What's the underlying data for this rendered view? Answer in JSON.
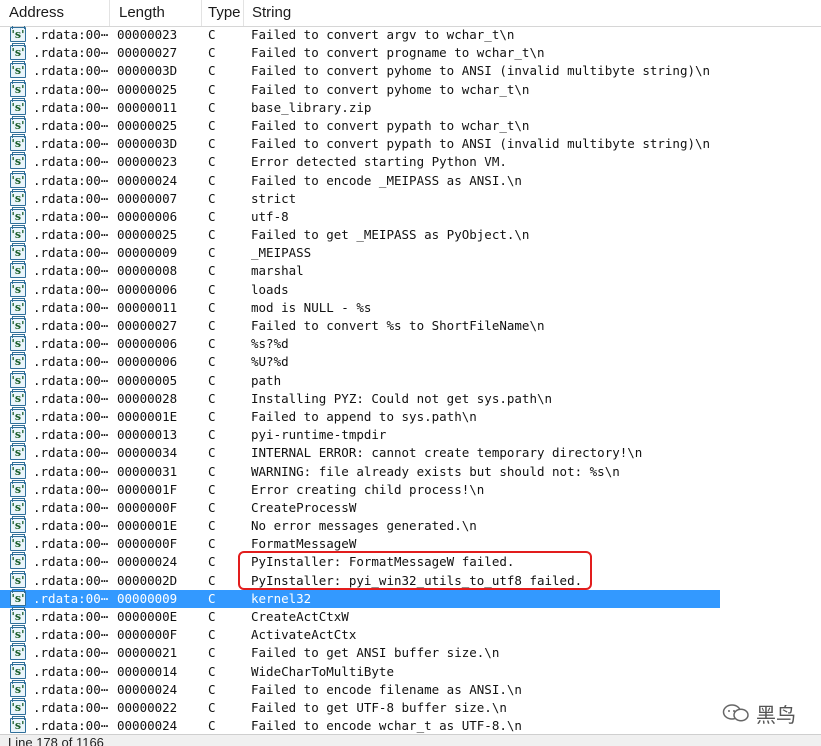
{
  "columns": {
    "address": "Address",
    "length": "Length",
    "type": "Type",
    "string": "String"
  },
  "icon_label": "'s'",
  "rows": [
    {
      "address": ".rdata:00⋯",
      "length": "00000023",
      "type": "C",
      "string": "Failed to convert argv to wchar_t\\n"
    },
    {
      "address": ".rdata:00⋯",
      "length": "00000027",
      "type": "C",
      "string": "Failed to convert progname to wchar_t\\n"
    },
    {
      "address": ".rdata:00⋯",
      "length": "0000003D",
      "type": "C",
      "string": "Failed to convert pyhome to ANSI (invalid multibyte string)\\n"
    },
    {
      "address": ".rdata:00⋯",
      "length": "00000025",
      "type": "C",
      "string": "Failed to convert pyhome to wchar_t\\n"
    },
    {
      "address": ".rdata:00⋯",
      "length": "00000011",
      "type": "C",
      "string": "base_library.zip"
    },
    {
      "address": ".rdata:00⋯",
      "length": "00000025",
      "type": "C",
      "string": "Failed to convert pypath to wchar_t\\n"
    },
    {
      "address": ".rdata:00⋯",
      "length": "0000003D",
      "type": "C",
      "string": "Failed to convert pypath to ANSI (invalid multibyte string)\\n"
    },
    {
      "address": ".rdata:00⋯",
      "length": "00000023",
      "type": "C",
      "string": "Error detected starting Python VM."
    },
    {
      "address": ".rdata:00⋯",
      "length": "00000024",
      "type": "C",
      "string": "Failed to encode _MEIPASS as ANSI.\\n"
    },
    {
      "address": ".rdata:00⋯",
      "length": "00000007",
      "type": "C",
      "string": "strict"
    },
    {
      "address": ".rdata:00⋯",
      "length": "00000006",
      "type": "C",
      "string": "utf-8"
    },
    {
      "address": ".rdata:00⋯",
      "length": "00000025",
      "type": "C",
      "string": "Failed to get _MEIPASS as PyObject.\\n"
    },
    {
      "address": ".rdata:00⋯",
      "length": "00000009",
      "type": "C",
      "string": "_MEIPASS"
    },
    {
      "address": ".rdata:00⋯",
      "length": "00000008",
      "type": "C",
      "string": "marshal"
    },
    {
      "address": ".rdata:00⋯",
      "length": "00000006",
      "type": "C",
      "string": "loads"
    },
    {
      "address": ".rdata:00⋯",
      "length": "00000011",
      "type": "C",
      "string": "mod is NULL - %s"
    },
    {
      "address": ".rdata:00⋯",
      "length": "00000027",
      "type": "C",
      "string": "Failed to convert %s to ShortFileName\\n"
    },
    {
      "address": ".rdata:00⋯",
      "length": "00000006",
      "type": "C",
      "string": "%s?%d"
    },
    {
      "address": ".rdata:00⋯",
      "length": "00000006",
      "type": "C",
      "string": "%U?%d"
    },
    {
      "address": ".rdata:00⋯",
      "length": "00000005",
      "type": "C",
      "string": "path"
    },
    {
      "address": ".rdata:00⋯",
      "length": "00000028",
      "type": "C",
      "string": "Installing PYZ: Could not get sys.path\\n"
    },
    {
      "address": ".rdata:00⋯",
      "length": "0000001E",
      "type": "C",
      "string": "Failed to append to sys.path\\n"
    },
    {
      "address": ".rdata:00⋯",
      "length": "00000013",
      "type": "C",
      "string": "pyi-runtime-tmpdir"
    },
    {
      "address": ".rdata:00⋯",
      "length": "00000034",
      "type": "C",
      "string": "INTERNAL ERROR: cannot create temporary directory!\\n"
    },
    {
      "address": ".rdata:00⋯",
      "length": "00000031",
      "type": "C",
      "string": "WARNING: file already exists but should not: %s\\n"
    },
    {
      "address": ".rdata:00⋯",
      "length": "0000001F",
      "type": "C",
      "string": "Error creating child process!\\n"
    },
    {
      "address": ".rdata:00⋯",
      "length": "0000000F",
      "type": "C",
      "string": "CreateProcessW"
    },
    {
      "address": ".rdata:00⋯",
      "length": "0000001E",
      "type": "C",
      "string": "No error messages generated.\\n"
    },
    {
      "address": ".rdata:00⋯",
      "length": "0000000F",
      "type": "C",
      "string": "FormatMessageW"
    },
    {
      "address": ".rdata:00⋯",
      "length": "00000024",
      "type": "C",
      "string": "PyInstaller: FormatMessageW failed."
    },
    {
      "address": ".rdata:00⋯",
      "length": "0000002D",
      "type": "C",
      "string": "PyInstaller: pyi_win32_utils_to_utf8 failed."
    },
    {
      "address": ".rdata:00⋯",
      "length": "00000009",
      "type": "C",
      "string": "kernel32",
      "selected": true
    },
    {
      "address": ".rdata:00⋯",
      "length": "0000000E",
      "type": "C",
      "string": "CreateActCtxW"
    },
    {
      "address": ".rdata:00⋯",
      "length": "0000000F",
      "type": "C",
      "string": "ActivateActCtx"
    },
    {
      "address": ".rdata:00⋯",
      "length": "00000021",
      "type": "C",
      "string": "Failed to get ANSI buffer size.\\n"
    },
    {
      "address": ".rdata:00⋯",
      "length": "00000014",
      "type": "C",
      "string": "WideCharToMultiByte"
    },
    {
      "address": ".rdata:00⋯",
      "length": "00000024",
      "type": "C",
      "string": "Failed to encode filename as ANSI.\\n"
    },
    {
      "address": ".rdata:00⋯",
      "length": "00000022",
      "type": "C",
      "string": "Failed to get UTF-8 buffer size.\\n"
    },
    {
      "address": ".rdata:00⋯",
      "length": "00000024",
      "type": "C",
      "string": "Failed to encode wchar_t as UTF-8.\\n"
    }
  ],
  "status_text": "Line 178 of 1166",
  "watermark": "黑鸟",
  "colors": {
    "selection": "#3399ff",
    "highlight_box": "#e21d1d",
    "icon_border": "#2f6f9a"
  }
}
